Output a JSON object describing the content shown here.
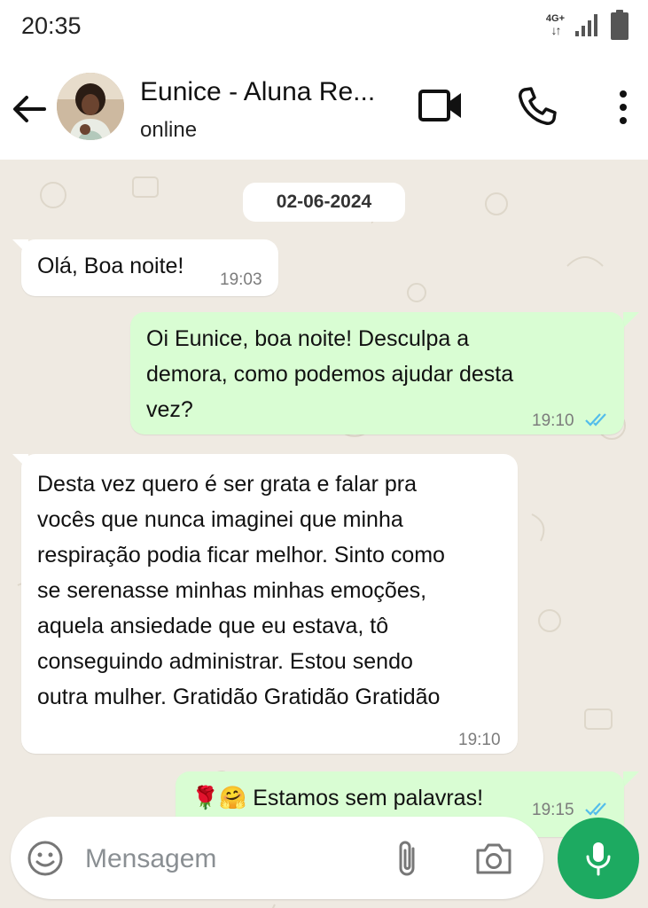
{
  "status_bar": {
    "time": "20:35",
    "network": "4G+"
  },
  "header": {
    "contact_name": "Eunice - Aluna Re...",
    "status": "online"
  },
  "chat": {
    "date": "02-06-2024",
    "messages": [
      {
        "direction": "in",
        "lines": [
          "Olá, Boa noite!"
        ],
        "time": "19:03"
      },
      {
        "direction": "out",
        "lines": [
          "Oi Eunice, boa noite! Desculpa a",
          "demora, como podemos ajudar desta",
          "vez?"
        ],
        "time": "19:10",
        "read": true
      },
      {
        "direction": "in",
        "lines": [
          "Desta vez quero é ser grata e falar pra",
          "vocês que nunca imaginei que minha",
          "respiração podia ficar melhor. Sinto como",
          "se serenasse minhas minhas emoções,",
          "aquela ansiedade que eu estava, tô",
          "conseguindo administrar. Estou sendo",
          "outra mulher. Gratidão Gratidão Gratidão"
        ],
        "time": "19:10"
      },
      {
        "direction": "out",
        "emojis": "🌹🤗",
        "lines": [
          "Estamos sem palavras!"
        ],
        "time": "19:15",
        "read": true
      }
    ]
  },
  "input": {
    "placeholder": "Mensagem"
  },
  "colors": {
    "accent_green": "#1daa61",
    "outgoing_bubble": "#d9fdd3",
    "read_ticks": "#53bdeb",
    "chat_background": "#efeae2"
  },
  "icons": [
    "back-arrow-icon",
    "video-call-icon",
    "phone-icon",
    "more-vert-icon",
    "emoji-icon",
    "attach-icon",
    "camera-icon",
    "mic-icon"
  ]
}
